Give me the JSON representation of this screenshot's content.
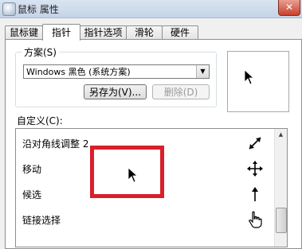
{
  "window": {
    "title": "鼠标 属性",
    "close_label": "✕"
  },
  "tabs": [
    {
      "label": "鼠标键",
      "active": false
    },
    {
      "label": "指针",
      "active": true
    },
    {
      "label": "指针选项",
      "active": false
    },
    {
      "label": "滑轮",
      "active": false
    },
    {
      "label": "硬件",
      "active": false
    }
  ],
  "scheme": {
    "label": "方案(S)",
    "selected": "Windows 黑色 (系统方案)",
    "save_as_label": "另存为(V)...",
    "delete_label": "删除(D)"
  },
  "customize": {
    "label": "自定义(C):",
    "rows": [
      {
        "label": "沿对角线调整 2",
        "icon": "diagonal-resize-icon"
      },
      {
        "label": "移动",
        "icon": "move-icon"
      },
      {
        "label": "候选",
        "icon": "up-arrow-icon"
      },
      {
        "label": "链接选择",
        "icon": "hand-pointer-icon"
      }
    ]
  },
  "colors": {
    "highlight": "#d81f2a"
  }
}
